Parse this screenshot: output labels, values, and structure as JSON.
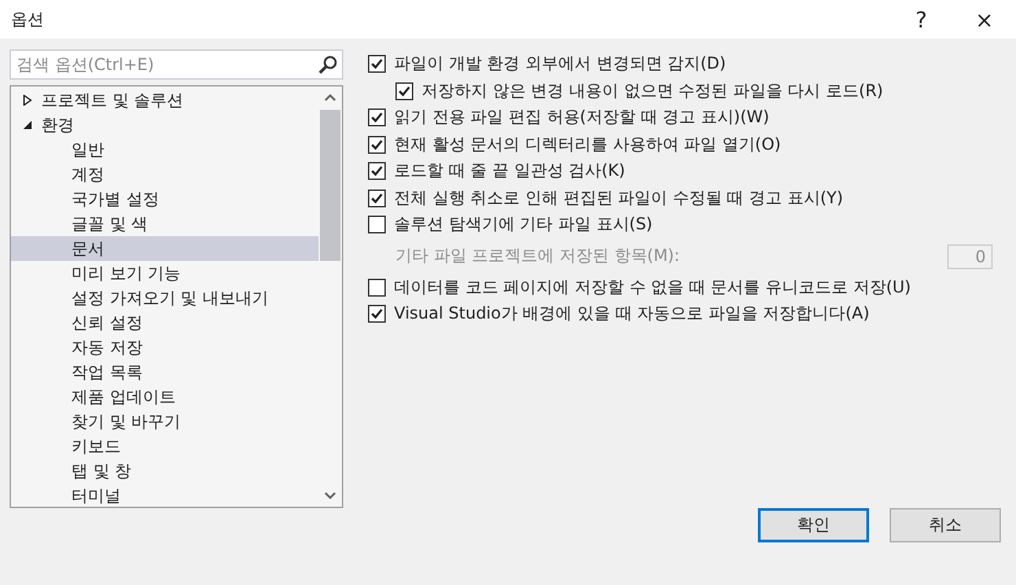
{
  "window": {
    "title": "옵션",
    "help": "?",
    "close": "×"
  },
  "search": {
    "placeholder": "검색 옵션(Ctrl+E)"
  },
  "tree": [
    {
      "label": "프로젝트 및 솔루션",
      "expanded": false,
      "selected": false
    },
    {
      "label": "환경",
      "expanded": true,
      "selected": false,
      "children": [
        {
          "label": "일반",
          "selected": false
        },
        {
          "label": "계정",
          "selected": false
        },
        {
          "label": "국가별 설정",
          "selected": false
        },
        {
          "label": "글꼴 및 색",
          "selected": false
        },
        {
          "label": "문서",
          "selected": true
        },
        {
          "label": "미리 보기 기능",
          "selected": false
        },
        {
          "label": "설정 가져오기 및 내보내기",
          "selected": false
        },
        {
          "label": "신뢰 설정",
          "selected": false
        },
        {
          "label": "자동 저장",
          "selected": false
        },
        {
          "label": "작업 목록",
          "selected": false
        },
        {
          "label": "제품 업데이트",
          "selected": false
        },
        {
          "label": "찾기 및 바꾸기",
          "selected": false
        },
        {
          "label": "키보드",
          "selected": false
        },
        {
          "label": "탭 및 창",
          "selected": false
        },
        {
          "label": "터미널",
          "selected": false
        }
      ]
    }
  ],
  "options": [
    {
      "kind": "checkbox",
      "label": "파일이 개발 환경 외부에서 변경되면 감지(D)",
      "checked": true,
      "children": [
        {
          "kind": "checkbox",
          "label": "저장하지 않은 변경 내용이 없으면 수정된 파일을 다시 로드(R)",
          "checked": true
        }
      ]
    },
    {
      "kind": "checkbox",
      "label": "읽기 전용 파일 편집 허용(저장할 때 경고 표시)(W)",
      "checked": true
    },
    {
      "kind": "checkbox",
      "label": "현재 활성 문서의 디렉터리를 사용하여 파일 열기(O)",
      "checked": true
    },
    {
      "kind": "checkbox",
      "label": "로드할 때 줄 끝 일관성 검사(K)",
      "checked": true
    },
    {
      "kind": "checkbox",
      "label": "전체 실행 취소로 인해 편집된 파일이 수정될 때 경고 표시(Y)",
      "checked": true
    },
    {
      "kind": "checkbox",
      "label": "솔루션 탐색기에 기타 파일 표시(S)",
      "checked": false,
      "children": [
        {
          "kind": "number",
          "label": "기타 파일 프로젝트에 저장된 항목(M):",
          "value": "0",
          "disabled": true
        }
      ]
    },
    {
      "kind": "checkbox",
      "label": "데이터를 코드 페이지에 저장할 수 없을 때 문서를 유니코드로 저장(U)",
      "checked": false
    },
    {
      "kind": "checkbox",
      "label": "Visual Studio가 배경에 있을 때 자동으로 파일을 저장합니다(A)",
      "checked": true
    }
  ],
  "buttons": [
    {
      "label": "확인",
      "default": true
    },
    {
      "label": "취소",
      "default": false
    }
  ]
}
